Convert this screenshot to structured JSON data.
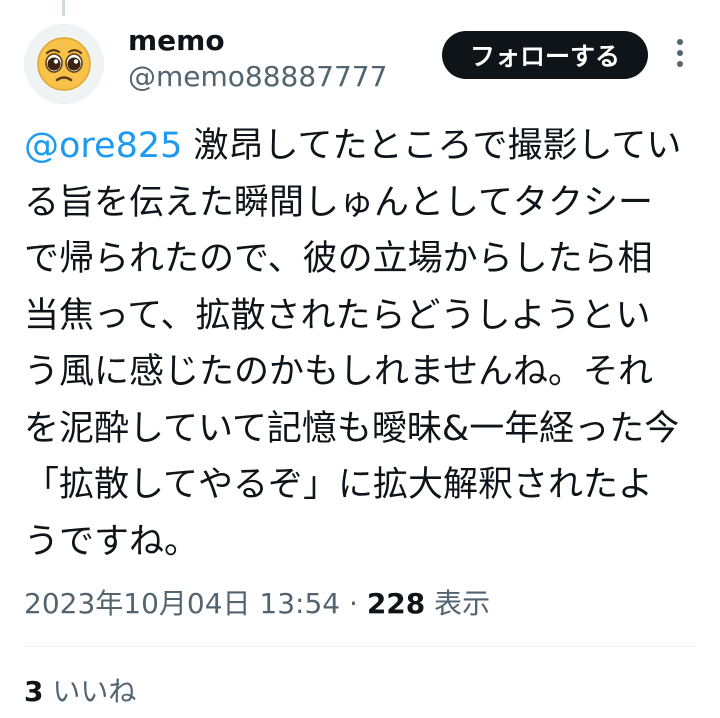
{
  "tweet": {
    "author": {
      "display_name": "memo",
      "handle": "@memo88887777",
      "avatar_icon": "pleading-face-emoji-icon",
      "avatar_glyph": "🥺"
    },
    "follow_label": "フォローする",
    "more_icon": "vertical-ellipsis-icon",
    "mention": "@ore825",
    "lines": {
      "l1": " 激昂してたところで撮影してい",
      "l2": "る旨を伝えた瞬間しゅんとしてタクシー",
      "l3": "で帰られたので、彼の立場からしたら相",
      "l4": "当焦って、拡散されたらどうしようとい",
      "l5": "う風に感じたのかもしれませんね。それ",
      "l6": "を泥酔していて記憶も曖昧&一年経った今",
      "l7": "「拡散してやるぞ」に拡大解釈されたよ",
      "l8": "うですね。"
    },
    "timestamp": "2023年10月04日 13:54",
    "separator": " · ",
    "views_count": "228",
    "views_label": " 表示",
    "likes_count": "3",
    "likes_label": " いいね"
  },
  "colors": {
    "text": "#0f1419",
    "secondary": "#536471",
    "link": "#1d9bf0",
    "button_bg": "#0f1419",
    "button_text": "#ffffff",
    "divider": "#eff3f4"
  }
}
